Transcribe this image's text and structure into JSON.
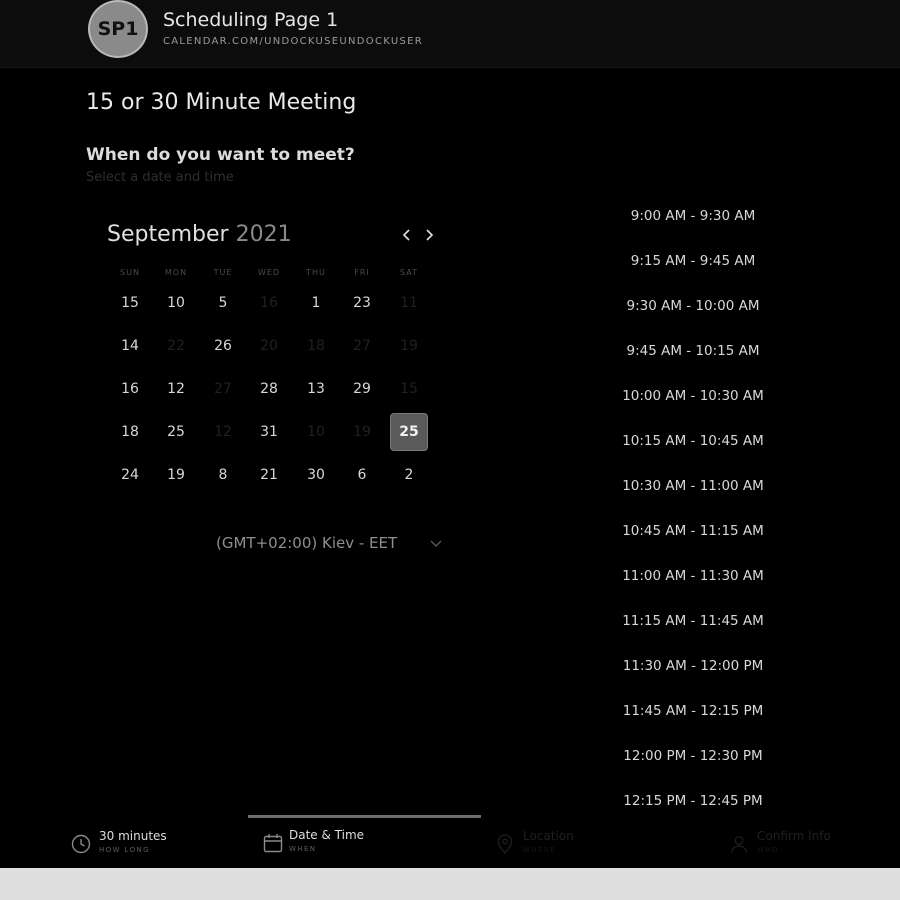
{
  "header": {
    "avatar_initials": "SP1",
    "title": "Scheduling Page 1",
    "url": "CALENDAR.COM/UNDOCKUSEUNDOCKUSER"
  },
  "page_title": "15 or 30 Minute Meeting",
  "question": "When do you want to meet?",
  "subtitle": "Select a date and time",
  "calendar": {
    "month": "September",
    "year": "2021",
    "weekdays": [
      "SUN",
      "MON",
      "TUE",
      "WED",
      "THU",
      "FRI",
      "SAT"
    ],
    "weeks": [
      [
        {
          "label": "15",
          "faded": false
        },
        {
          "label": "10",
          "faded": false
        },
        {
          "label": "5",
          "faded": false
        },
        {
          "label": "16",
          "faded": true
        },
        {
          "label": "1",
          "faded": false
        },
        {
          "label": "23",
          "faded": false
        },
        {
          "label": "11",
          "faded": true
        }
      ],
      [
        {
          "label": "14",
          "faded": false
        },
        {
          "label": "22",
          "faded": true
        },
        {
          "label": "26",
          "faded": false
        },
        {
          "label": "20",
          "faded": true
        },
        {
          "label": "18",
          "faded": true
        },
        {
          "label": "27",
          "faded": true
        },
        {
          "label": "19",
          "faded": true
        }
      ],
      [
        {
          "label": "16",
          "faded": false
        },
        {
          "label": "12",
          "faded": false
        },
        {
          "label": "27",
          "faded": true
        },
        {
          "label": "28",
          "faded": false
        },
        {
          "label": "13",
          "faded": false
        },
        {
          "label": "29",
          "faded": false
        },
        {
          "label": "15",
          "faded": true
        }
      ],
      [
        {
          "label": "18",
          "faded": false
        },
        {
          "label": "25",
          "faded": false
        },
        {
          "label": "12",
          "faded": true
        },
        {
          "label": "31",
          "faded": false
        },
        {
          "label": "10",
          "faded": true
        },
        {
          "label": "19",
          "faded": true
        },
        {
          "label": "25",
          "faded": false,
          "selected": true
        }
      ],
      [
        {
          "label": "24",
          "faded": false
        },
        {
          "label": "19",
          "faded": false
        },
        {
          "label": "8",
          "faded": false
        },
        {
          "label": "21",
          "faded": false
        },
        {
          "label": "30",
          "faded": false
        },
        {
          "label": "6",
          "faded": false
        },
        {
          "label": "2",
          "faded": false
        }
      ]
    ]
  },
  "timezone": "(GMT+02:00) Kiev - EET",
  "time_slots": [
    "9:00 AM - 9:30 AM",
    "9:15 AM - 9:45 AM",
    "9:30 AM - 10:00 AM",
    "9:45 AM - 10:15 AM",
    "10:00 AM - 10:30 AM",
    "10:15 AM - 10:45 AM",
    "10:30 AM - 11:00 AM",
    "10:45 AM - 11:15 AM",
    "11:00 AM - 11:30 AM",
    "11:15 AM - 11:45 AM",
    "11:30 AM - 12:00 PM",
    "11:45 AM - 12:15 PM",
    "12:00 PM - 12:30 PM",
    "12:15 PM - 12:45 PM"
  ],
  "footer": {
    "steps": [
      {
        "label": "30 minutes",
        "sub": "HOW LONG",
        "icon": "clock-icon"
      },
      {
        "label": "Date & Time",
        "sub": "WHEN",
        "icon": "calendar-icon"
      },
      {
        "label": "Location",
        "sub": "WHERE",
        "icon": "location-icon"
      },
      {
        "label": "Confirm Info",
        "sub": "WHO",
        "icon": "person-icon"
      }
    ]
  }
}
